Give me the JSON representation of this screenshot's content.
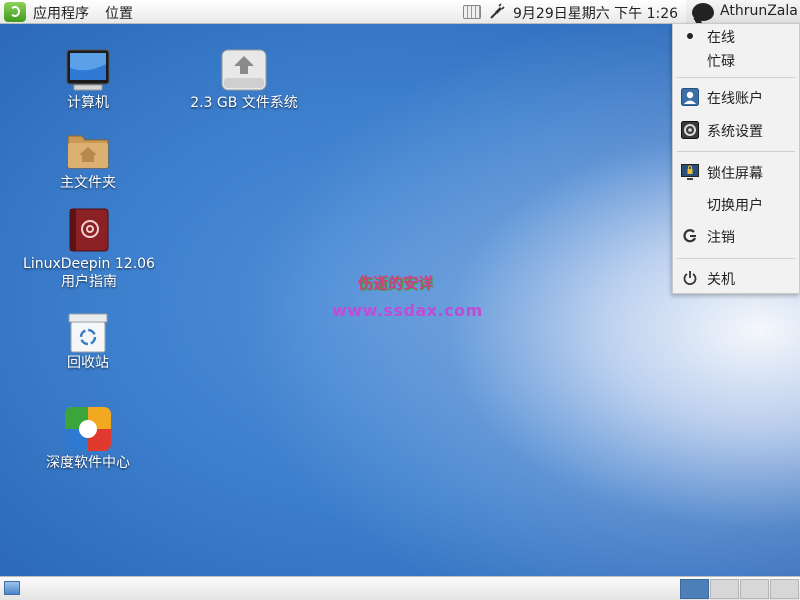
{
  "top_panel": {
    "applications_menu": "应用程序",
    "places_menu": "位置",
    "date": "9月29日星期六 下午  1:26",
    "username": "AthrunZala"
  },
  "user_menu": {
    "items": [
      {
        "label": "在线",
        "icon": "bullet-icon"
      },
      {
        "label": "忙碌",
        "icon": ""
      },
      {
        "label": "在线账户",
        "icon": "accounts-icon"
      },
      {
        "label": "系统设置",
        "icon": "settings-icon"
      },
      {
        "label": "锁住屏幕",
        "icon": "lock-screen-icon"
      },
      {
        "label": "切换用户",
        "icon": ""
      },
      {
        "label": "注销",
        "icon": "logout-icon"
      },
      {
        "label": "关机",
        "icon": "power-icon"
      }
    ]
  },
  "desktop": {
    "icons": [
      {
        "label": "计算机",
        "icon": "computer-icon"
      },
      {
        "label": "2.3 GB 文件系统",
        "icon": "drive-icon"
      },
      {
        "label": "主文件夹",
        "icon": "home-folder-icon"
      },
      {
        "label_line1": "LinuxDeepin 12.06",
        "label_line2": "用户指南",
        "icon": "user-guide-icon"
      },
      {
        "label": "回收站",
        "icon": "trash-icon"
      },
      {
        "label": "深度软件中心",
        "icon": "software-center-icon"
      }
    ],
    "watermark_line1": "伤逝的安详",
    "watermark_line2": "www.ssdax.com"
  },
  "bottom_panel": {
    "workspace_count": 4,
    "active_workspace": 1
  },
  "colors": {
    "desktop_blue": "#2f6dbd",
    "panel": "#e9e9e9",
    "active_workspace": "#4d7fb8"
  }
}
